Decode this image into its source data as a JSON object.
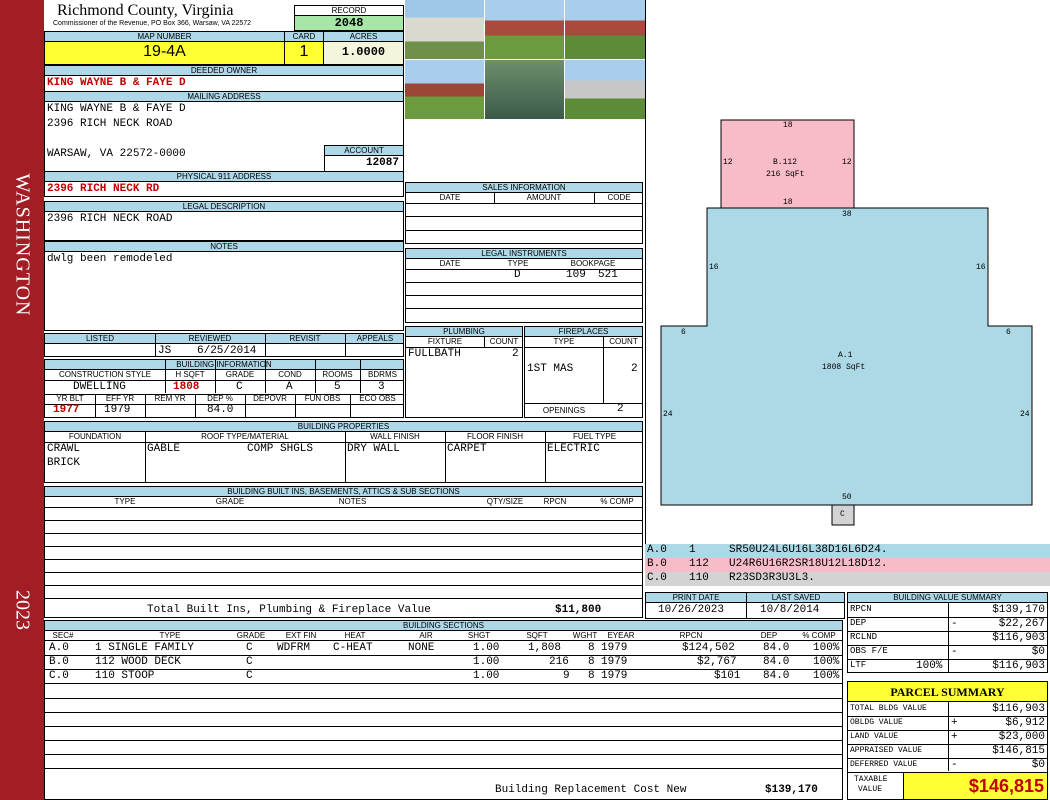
{
  "side": {
    "name": "WASHINGTON",
    "year": "2023"
  },
  "county": {
    "title": "Richmond County, Virginia",
    "sub": "Commissioner of the Revenue, PO Box 366, Warsaw, VA 22572"
  },
  "record": {
    "label": "RECORD",
    "value": "2048"
  },
  "map": {
    "label": "MAP NUMBER",
    "value": "19-4A"
  },
  "card": {
    "label": "CARD",
    "value": "1"
  },
  "acres": {
    "label": "ACRES",
    "value": "1.0000"
  },
  "owner": {
    "label": "DEEDED OWNER",
    "value": "KING WAYNE B & FAYE D"
  },
  "mailing": {
    "label": "MAILING ADDRESS",
    "line1": "KING WAYNE B & FAYE D",
    "line2": "2396 RICH NECK ROAD",
    "line3": "WARSAW, VA 22572-0000"
  },
  "account": {
    "label": "ACCOUNT",
    "value": "12087"
  },
  "physical": {
    "label": "PHYSICAL 911 ADDRESS",
    "value": "2396 RICH NECK RD"
  },
  "legal": {
    "label": "LEGAL DESCRIPTION",
    "value": "2396 RICH NECK ROAD"
  },
  "notes": {
    "label": "NOTES",
    "value": "dwlg been remodeled"
  },
  "review": {
    "listed": "LISTED",
    "reviewed": "REVIEWED",
    "revisit": "REVISIT",
    "appeals": "APPEALS",
    "reviewer": "JS",
    "date": "6/25/2014"
  },
  "bldg": {
    "label": "BUILDING INFORMATION",
    "h_style": "CONSTRUCTION STYLE",
    "h_sqft": "H SQFT",
    "h_grade": "GRADE",
    "h_cond": "COND",
    "h_rooms": "ROOMS",
    "h_bdrms": "BDRMS",
    "style": "DWELLING",
    "sqft": "1808",
    "grade": "C",
    "cond": "A",
    "rooms": "5",
    "bdrms": "3",
    "h_yrblt": "YR BLT",
    "h_effyr": "EFF YR",
    "h_remyr": "REM YR",
    "h_dep": "DEP %",
    "h_depovr": "DEPOVR",
    "h_funobs": "FUN OBS",
    "h_ecoobs": "ECO OBS",
    "yrblt": "1977",
    "effyr": "1979",
    "dep": "84.0"
  },
  "sales": {
    "label": "SALES INFORMATION",
    "date": "DATE",
    "amount": "AMOUNT",
    "code": "CODE"
  },
  "instr": {
    "label": "LEGAL INSTRUMENTS",
    "date": "DATE",
    "type": "TYPE",
    "bookpage": "BOOKPAGE",
    "r_type": "D",
    "r_book": "109",
    "r_page": "521"
  },
  "plumb": {
    "label": "PLUMBING",
    "fixture": "FIXTURE",
    "count": "COUNT",
    "r_fixture": "FULLBATH",
    "r_count": "2"
  },
  "fire": {
    "label": "FIREPLACES",
    "type": "TYPE",
    "count": "COUNT",
    "r_type": "1ST MAS",
    "r_count": "2",
    "openings": "OPENINGS",
    "open_count": "2"
  },
  "props": {
    "label": "BUILDING PROPERTIES",
    "foundation": "FOUNDATION",
    "roof": "ROOF TYPE/MATERIAL",
    "wall": "WALL FINISH",
    "floor": "FLOOR FINISH",
    "fuel": "FUEL TYPE",
    "f1": "CRAWL",
    "f2": "BRICK",
    "roof1": "GABLE",
    "roof2": "COMP SHGLS",
    "wall_v": "DRY WALL",
    "floor_v": "CARPET",
    "fuel_v": "ELECTRIC"
  },
  "builtins": {
    "label": "BUILDING BUILT INS, BASEMENTS, ATTICS & SUB SECTIONS",
    "type": "TYPE",
    "grade": "GRADE",
    "notes": "NOTES",
    "qty": "QTY/SIZE",
    "rpcn": "RPCN",
    "comp": "% COMP",
    "total_label": "Total Built Ins, Plumbing & Fireplace Value",
    "total": "$11,800"
  },
  "dates": {
    "print_label": "PRINT DATE",
    "saved_label": "LAST SAVED",
    "print": "10/26/2023",
    "saved": "10/8/2014"
  },
  "sketch": {
    "b_label": "B.112",
    "b_area": "216 SqFt",
    "a_label": "A.1",
    "a_area": "1808 SqFt",
    "c_label": "C",
    "n18a": "18",
    "n12a": "12",
    "n12b": "12",
    "n18b": "18",
    "n38": "38",
    "n16a": "16",
    "n16b": "16",
    "n6a": "6",
    "n6b": "6",
    "n24a": "24",
    "n24b": "24",
    "n50": "50"
  },
  "codes": [
    {
      "sec": "A.0",
      "num": "1",
      "code": "SR50U24L6U16L38D16L6D24."
    },
    {
      "sec": "B.0",
      "num": "112",
      "code": "U24R6U16R2SR18U12L18D12."
    },
    {
      "sec": "C.0",
      "num": "110",
      "code": "R23SD3R3U3L3."
    }
  ],
  "sections": {
    "label": "BUILDING SECTIONS",
    "h": [
      "SEC#",
      "TYPE",
      "GRADE",
      "EXT FIN",
      "HEAT",
      "AIR",
      "SHGT",
      "SQFT",
      "WGHT",
      "EYEAR",
      "RPCN",
      "DEP",
      "% COMP"
    ],
    "rows": [
      [
        "A.0",
        "1 SINGLE FAMILY",
        "C",
        "WDFRM",
        "C-HEAT",
        "NONE",
        "1.00",
        "1,808",
        "8",
        "1979",
        "$124,502",
        "84.0",
        "100%"
      ],
      [
        "B.0",
        "112 WOOD DECK",
        "C",
        "",
        "",
        "",
        "1.00",
        "216",
        "8",
        "1979",
        "$2,767",
        "84.0",
        "100%"
      ],
      [
        "C.0",
        "110 STOOP",
        "C",
        "",
        "",
        "",
        "1.00",
        "9",
        "8",
        "1979",
        "$101",
        "84.0",
        "100%"
      ]
    ],
    "repl_label": "Building Replacement Cost New",
    "repl_value": "$139,170"
  },
  "bvs": {
    "label": "BUILDING VALUE SUMMARY",
    "rpcn_l": "RPCN",
    "rpcn": "$139,170",
    "dep_l": "DEP",
    "dep_s": "-",
    "dep": "$22,267",
    "rclnd_l": "RCLND",
    "rclnd": "$116,903",
    "obs_l": "OBS F/E",
    "obs_s": "-",
    "obs": "$0",
    "ltf_l": "LTF",
    "ltf_p": "100%",
    "ltf": "$116,903"
  },
  "parcel": {
    "label": "PARCEL SUMMARY",
    "tbv_l": "TOTAL BLDG VALUE",
    "tbv": "$116,903",
    "obldg_l": "OBLDG VALUE",
    "obldg_s": "+",
    "obldg": "$6,912",
    "land_l": "LAND VALUE",
    "land_s": "+",
    "land": "$23,000",
    "appr_l": "APPRAISED VALUE",
    "appr": "$146,815",
    "def_l": "DEFERRED VALUE",
    "def_s": "-",
    "def": "$0",
    "tax_l1": "TAXABLE",
    "tax_l2": "VALUE",
    "tax": "$146,815"
  }
}
